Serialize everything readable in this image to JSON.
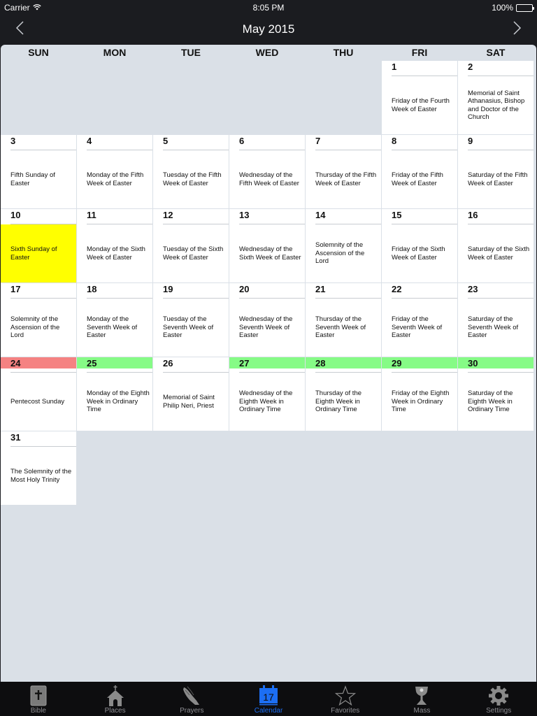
{
  "status_bar": {
    "carrier": "Carrier",
    "time": "8:05 PM",
    "battery": "100%",
    "battery_level": 1.0
  },
  "nav": {
    "title": "May 2015",
    "prev_icon": "chevron-left-icon",
    "next_icon": "chevron-right-icon"
  },
  "weekdays": [
    "SUN",
    "MON",
    "TUE",
    "WED",
    "THU",
    "FRI",
    "SAT"
  ],
  "colors": {
    "panel_bg": "#dae0e7",
    "today_yellow": "#ffff00",
    "pentecost_red": "#f58282",
    "ordinary_green": "#86fb86",
    "active_tab": "#1c6ef3"
  },
  "days": [
    {
      "day": "1",
      "col": 5,
      "row": 0,
      "desc": "Friday of the Fourth Week of Easter",
      "highlight": ""
    },
    {
      "day": "2",
      "col": 6,
      "row": 0,
      "desc": "Memorial of Saint Athanasius, Bishop and Doctor of the Church",
      "highlight": ""
    },
    {
      "day": "3",
      "col": 0,
      "row": 1,
      "desc": "Fifth Sunday of Easter",
      "highlight": ""
    },
    {
      "day": "4",
      "col": 1,
      "row": 1,
      "desc": "Monday of the Fifth Week of Easter",
      "highlight": ""
    },
    {
      "day": "5",
      "col": 2,
      "row": 1,
      "desc": "Tuesday of the Fifth Week of Easter",
      "highlight": ""
    },
    {
      "day": "6",
      "col": 3,
      "row": 1,
      "desc": "Wednesday of the Fifth Week of Easter",
      "highlight": ""
    },
    {
      "day": "7",
      "col": 4,
      "row": 1,
      "desc": "Thursday of the Fifth Week of Easter",
      "highlight": ""
    },
    {
      "day": "8",
      "col": 5,
      "row": 1,
      "desc": "Friday of the Fifth Week of Easter",
      "highlight": ""
    },
    {
      "day": "9",
      "col": 6,
      "row": 1,
      "desc": "Saturday of the Fifth Week of Easter",
      "highlight": ""
    },
    {
      "day": "10",
      "col": 0,
      "row": 2,
      "desc": "Sixth Sunday of Easter",
      "highlight": "yellow"
    },
    {
      "day": "11",
      "col": 1,
      "row": 2,
      "desc": "Monday of the Sixth Week  of Easter",
      "highlight": ""
    },
    {
      "day": "12",
      "col": 2,
      "row": 2,
      "desc": "Tuesday of the Sixth Week of Easter",
      "highlight": ""
    },
    {
      "day": "13",
      "col": 3,
      "row": 2,
      "desc": "Wednesday of the Sixth Week of Easter",
      "highlight": ""
    },
    {
      "day": "14",
      "col": 4,
      "row": 2,
      "desc": "Solemnity of the Ascension of the Lord",
      "highlight": ""
    },
    {
      "day": "15",
      "col": 5,
      "row": 2,
      "desc": "Friday of the Sixth Week of Easter",
      "highlight": ""
    },
    {
      "day": "16",
      "col": 6,
      "row": 2,
      "desc": "Saturday of the Sixth Week of Easter",
      "highlight": ""
    },
    {
      "day": "17",
      "col": 0,
      "row": 3,
      "desc": "Solemnity of the Ascension of the Lord",
      "highlight": ""
    },
    {
      "day": "18",
      "col": 1,
      "row": 3,
      "desc": "Monday of the Seventh Week of Easter",
      "highlight": ""
    },
    {
      "day": "19",
      "col": 2,
      "row": 3,
      "desc": "Tuesday of the Seventh Week of Easter",
      "highlight": ""
    },
    {
      "day": "20",
      "col": 3,
      "row": 3,
      "desc": "Wednesday of the Seventh Week of Easter",
      "highlight": ""
    },
    {
      "day": "21",
      "col": 4,
      "row": 3,
      "desc": "Thursday of the Seventh Week of Easter",
      "highlight": ""
    },
    {
      "day": "22",
      "col": 5,
      "row": 3,
      "desc": "Friday of the Seventh Week of Easter",
      "highlight": ""
    },
    {
      "day": "23",
      "col": 6,
      "row": 3,
      "desc": "Saturday of the Seventh Week of Easter",
      "highlight": ""
    },
    {
      "day": "24",
      "col": 0,
      "row": 4,
      "desc": "Pentecost Sunday",
      "highlight": "red"
    },
    {
      "day": "25",
      "col": 1,
      "row": 4,
      "desc": "Monday of the Eighth Week in Ordinary Time",
      "highlight": "green"
    },
    {
      "day": "26",
      "col": 2,
      "row": 4,
      "desc": "Memorial of Saint Philip Neri, Priest",
      "highlight": ""
    },
    {
      "day": "27",
      "col": 3,
      "row": 4,
      "desc": "Wednesday of the Eighth Week in Ordinary Time",
      "highlight": "green"
    },
    {
      "day": "28",
      "col": 4,
      "row": 4,
      "desc": "Thursday of the Eighth Week in Ordinary Time",
      "highlight": "green"
    },
    {
      "day": "29",
      "col": 5,
      "row": 4,
      "desc": "Friday of the Eighth Week in Ordinary Time",
      "highlight": "green"
    },
    {
      "day": "30",
      "col": 6,
      "row": 4,
      "desc": "Saturday of the Eighth Week in Ordinary Time",
      "highlight": "green"
    },
    {
      "day": "31",
      "col": 0,
      "row": 5,
      "desc": "The Solemnity of the Most Holy Trinity",
      "highlight": ""
    }
  ],
  "tabs": [
    {
      "label": "Bible",
      "icon": "bible-icon",
      "active": false
    },
    {
      "label": "Places",
      "icon": "church-icon",
      "active": false
    },
    {
      "label": "Prayers",
      "icon": "praying-hands-icon",
      "active": false
    },
    {
      "label": "Calendar",
      "icon": "calendar-icon",
      "active": true,
      "icon_text": "17"
    },
    {
      "label": "Favorites",
      "icon": "star-icon",
      "active": false
    },
    {
      "label": "Mass",
      "icon": "chalice-icon",
      "active": false
    },
    {
      "label": "Settings",
      "icon": "gear-icon",
      "active": false
    }
  ]
}
